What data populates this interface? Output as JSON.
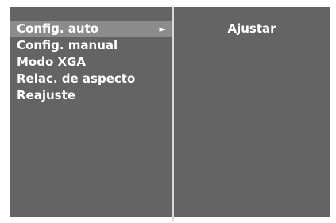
{
  "menu": {
    "items": [
      {
        "label": "Config. auto"
      },
      {
        "label": "Config. manual"
      },
      {
        "label": "Modo XGA"
      },
      {
        "label": "Relac. de aspecto"
      },
      {
        "label": "Reajuste"
      }
    ],
    "selected_arrow": "►"
  },
  "submenu": {
    "action_label": "Ajustar"
  },
  "colors": {
    "panel_bg": "#646464",
    "highlight_bg": "#8c8c8c",
    "divider": "#d9d9d9",
    "text": "#ffffff"
  }
}
